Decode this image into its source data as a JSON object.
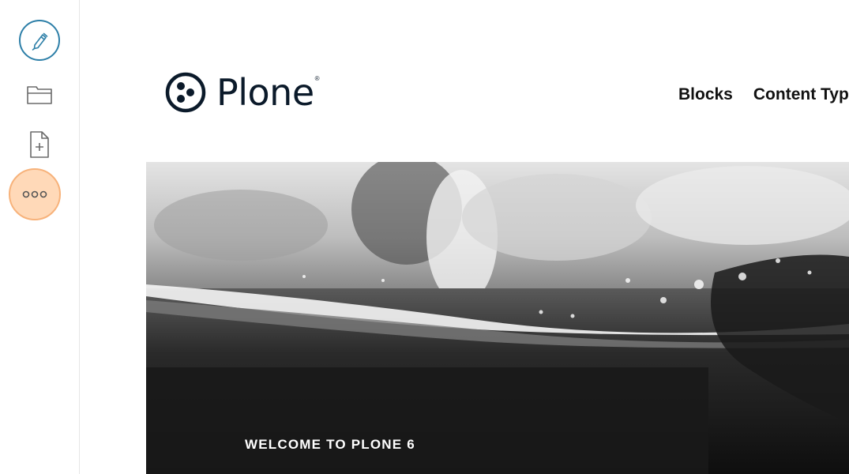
{
  "toolbar": {
    "edit_icon": "pencil-icon",
    "contents_icon": "folder-icon",
    "add_icon": "add-document-icon",
    "more_icon": "more-icon",
    "more_highlight_color": "#ffd9b8",
    "accent_color": "#2d7fa8"
  },
  "header": {
    "logo_text": "Plone",
    "logo_mark": "®",
    "nav": [
      {
        "label": "Blocks"
      },
      {
        "label": "Content Typ"
      }
    ]
  },
  "hero": {
    "title": "WELCOME TO PLONE 6"
  }
}
